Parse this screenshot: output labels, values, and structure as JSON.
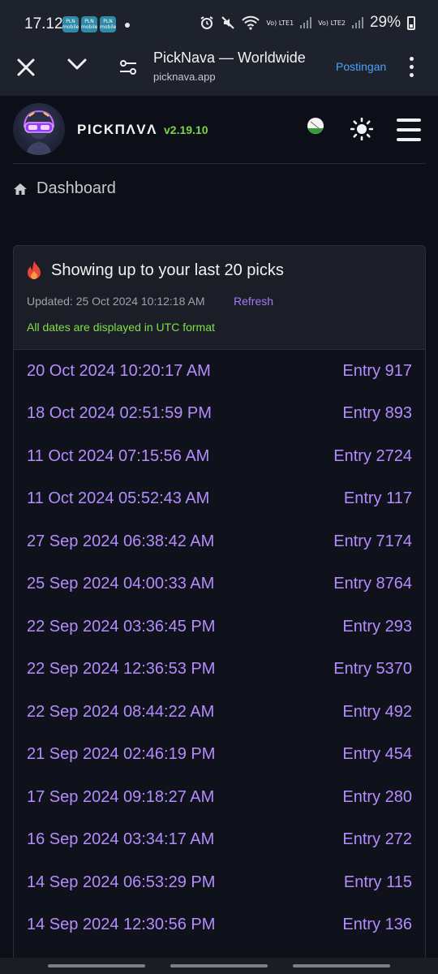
{
  "status_bar": {
    "time": "17.12",
    "apps": [
      "PLN mobile",
      "PLN mobile",
      "PLN mobile"
    ],
    "lte1": "Vo) LTE1",
    "lte2": "Vo) LTE2",
    "battery": "29%"
  },
  "browser": {
    "title": "PickNava — Worldwide",
    "url": "picknava.app",
    "action_label": "Postingan"
  },
  "header": {
    "logo_text": "PICKΠΛVΛ",
    "version": "v2.19.10"
  },
  "breadcrumb": {
    "label": "Dashboard"
  },
  "card": {
    "title": "Showing up to your last 20 picks",
    "updated": "Updated: 25 Oct 2024 10:12:18 AM",
    "refresh_label": "Refresh",
    "utc_note": "All dates are displayed in UTC format"
  },
  "picks": [
    {
      "date": "20 Oct 2024 10:20:17 AM",
      "entry": "Entry 917"
    },
    {
      "date": "18 Oct 2024 02:51:59 PM",
      "entry": "Entry 893"
    },
    {
      "date": "11 Oct 2024 07:15:56 AM",
      "entry": "Entry 2724"
    },
    {
      "date": "11 Oct 2024 05:52:43 AM",
      "entry": "Entry 117"
    },
    {
      "date": "27 Sep 2024 06:38:42 AM",
      "entry": "Entry 7174"
    },
    {
      "date": "25 Sep 2024 04:00:33 AM",
      "entry": "Entry 8764"
    },
    {
      "date": "22 Sep 2024 03:36:45 PM",
      "entry": "Entry 293"
    },
    {
      "date": "22 Sep 2024 12:36:53 PM",
      "entry": "Entry 5370"
    },
    {
      "date": "22 Sep 2024 08:44:22 AM",
      "entry": "Entry 492"
    },
    {
      "date": "21 Sep 2024 02:46:19 PM",
      "entry": "Entry 454"
    },
    {
      "date": "17 Sep 2024 09:18:27 AM",
      "entry": "Entry 280"
    },
    {
      "date": "16 Sep 2024 03:34:17 AM",
      "entry": "Entry 272"
    },
    {
      "date": "14 Sep 2024 06:53:29 PM",
      "entry": "Entry 115"
    },
    {
      "date": "14 Sep 2024 12:30:56 PM",
      "entry": "Entry 136"
    }
  ],
  "colors": {
    "accent": "#b48cff",
    "version_green": "#7cd44a",
    "link_blue": "#4aa3ff"
  }
}
